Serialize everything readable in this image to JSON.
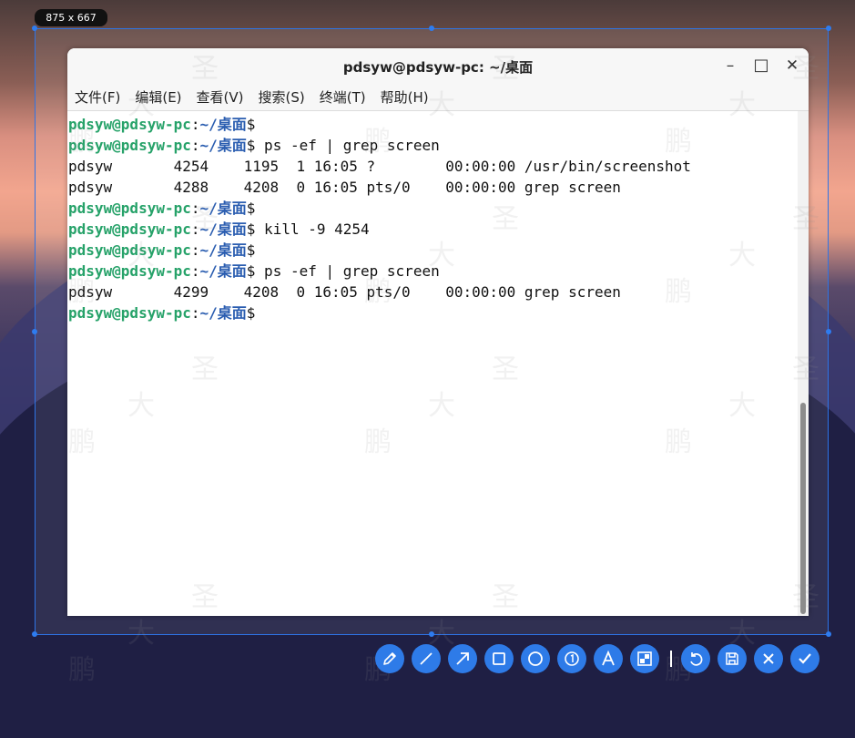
{
  "size_label": "875 x 667",
  "window": {
    "title": "pdsyw@pdsyw-pc: ~/桌面",
    "minimize": "–",
    "maximize": "□",
    "close": "✕"
  },
  "menu": [
    "文件(F)",
    "编辑(E)",
    "查看(V)",
    "搜索(S)",
    "终端(T)",
    "帮助(H)"
  ],
  "prompt": {
    "user_host": "pdsyw@pdsyw-pc",
    "colon": ":",
    "dir": "~/桌面",
    "symbol": "$"
  },
  "terminal_lines": [
    {
      "type": "prompt",
      "cmd": ""
    },
    {
      "type": "prompt",
      "cmd": " ps -ef | grep screen"
    },
    {
      "type": "output",
      "text": "pdsyw       4254    1195  1 16:05 ?        00:00:00 /usr/bin/screenshot"
    },
    {
      "type": "output",
      "text": "pdsyw       4288    4208  0 16:05 pts/0    00:00:00 grep screen"
    },
    {
      "type": "prompt",
      "cmd": ""
    },
    {
      "type": "prompt",
      "cmd": " kill -9 4254"
    },
    {
      "type": "prompt",
      "cmd": ""
    },
    {
      "type": "prompt",
      "cmd": " ps -ef | grep screen"
    },
    {
      "type": "output",
      "text": "pdsyw       4299    4208  0 16:05 pts/0    00:00:00 grep screen"
    },
    {
      "type": "prompt",
      "cmd": ""
    }
  ],
  "watermark_chars": [
    "鹏",
    "大",
    "圣"
  ],
  "toolbar": [
    "pencil-icon",
    "line-icon",
    "arrow-icon",
    "rectangle-icon",
    "ellipse-icon",
    "number-marker-icon",
    "text-icon",
    "mosaic-icon",
    "undo-icon",
    "save-icon",
    "cancel-icon",
    "confirm-icon"
  ],
  "colors": {
    "accent": "#2e7be8",
    "prompt_user": "#26a269",
    "prompt_dir": "#2a5db0"
  }
}
